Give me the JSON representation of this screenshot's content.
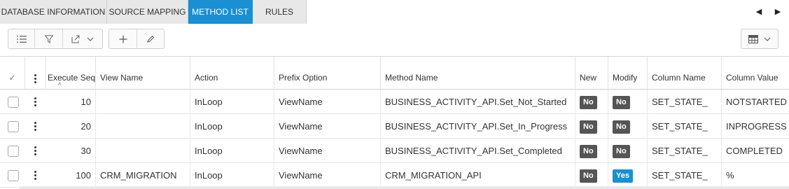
{
  "tabs": [
    {
      "label": "DATABASE INFORMATION",
      "active": false
    },
    {
      "label": "SOURCE MAPPING",
      "active": false
    },
    {
      "label": "METHOD LIST",
      "active": true
    },
    {
      "label": "RULES",
      "active": false
    }
  ],
  "nav": {
    "prev_glyph": "◀",
    "next_glyph": "▶"
  },
  "toolbar": {
    "icons": [
      "list-icon",
      "filter-icon",
      "export-icon",
      "chevron-down-icon",
      "add-icon",
      "edit-icon",
      "table-settings-icon"
    ]
  },
  "grid": {
    "columns": {
      "select": "✓",
      "execute_seq": "Execute Seq",
      "view_name": "View Name",
      "action": "Action",
      "prefix_option": "Prefix Option",
      "method_name": "Method Name",
      "new": "New",
      "modify": "Modify",
      "column_name": "Column Name",
      "column_value": "Column Value"
    },
    "sort_indicator": "^",
    "rows": [
      {
        "execute_seq": "10",
        "view_name": "",
        "action": "InLoop",
        "prefix_option": "ViewName",
        "method_name": "BUSINESS_ACTIVITY_API.Set_Not_Started",
        "new": "No",
        "modify": "No",
        "column_name": "SET_STATE_",
        "column_value": "NOTSTARTED"
      },
      {
        "execute_seq": "20",
        "view_name": "",
        "action": "InLoop",
        "prefix_option": "ViewName",
        "method_name": "BUSINESS_ACTIVITY_API.Set_In_Progress",
        "new": "No",
        "modify": "No",
        "column_name": "SET_STATE_",
        "column_value": "INPROGRESS"
      },
      {
        "execute_seq": "30",
        "view_name": "",
        "action": "InLoop",
        "prefix_option": "ViewName",
        "method_name": "BUSINESS_ACTIVITY_API.Set_Completed",
        "new": "No",
        "modify": "No",
        "column_name": "SET_STATE_",
        "column_value": "COMPLETED"
      },
      {
        "execute_seq": "100",
        "view_name": "CRM_MIGRATION",
        "action": "InLoop",
        "prefix_option": "ViewName",
        "method_name": "CRM_MIGRATION_API",
        "new": "No",
        "modify": "Yes",
        "column_name": "SET_STATE_",
        "column_value": "%"
      }
    ]
  },
  "colors": {
    "accent": "#1a8fd1",
    "badge_no": "#555555",
    "badge_yes": "#1a8fd1"
  }
}
